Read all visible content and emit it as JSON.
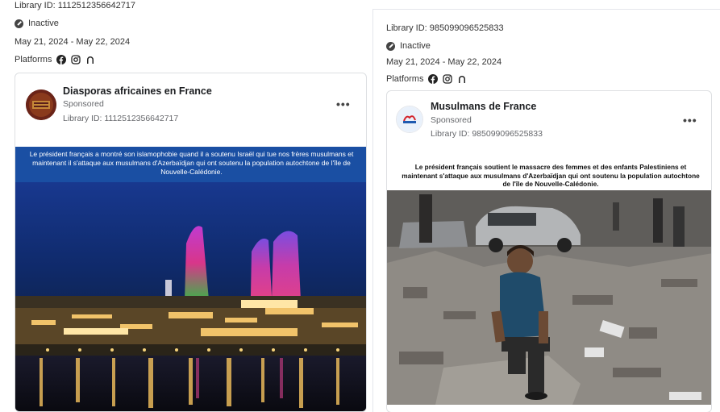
{
  "left_ad": {
    "library_id": "Library ID: 1112512356642717",
    "status": "Inactive",
    "date_range": "May 21, 2024 - May 22, 2024",
    "platforms_label": "Platforms",
    "page_name": "Diasporas africaines en France",
    "sponsored": "Sponsored",
    "library_id_sub": "Library ID: 1112512356642717",
    "more_label": "•••",
    "caption": "Le président français a montré son islamophobie quand il a soutenu Israël qui tue nos frères musulmans et maintenant il s'attaque aux musulmans d'Azerbaïdjan qui ont soutenu la population autochtone de l'île de Nouvelle-Calédonie."
  },
  "right_ad": {
    "library_id": "Library ID: 985099096525833",
    "status": "Inactive",
    "date_range": "May 21, 2024 - May 22, 2024",
    "platforms_label": "Platforms",
    "page_name": "Musulmans de France",
    "sponsored": "Sponsored",
    "library_id_sub": "Library ID: 985099096525833",
    "more_label": "•••",
    "caption": "Le président français soutient le massacre des femmes et des enfants Palestiniens et maintenant s'attaque aux musulmans d'Azerbaïdjan qui ont soutenu la population autochtone de l'île de Nouvelle-Calédonie."
  },
  "colors": {
    "caption_band_left": "#1a4fa3",
    "text_secondary": "#65676b"
  }
}
